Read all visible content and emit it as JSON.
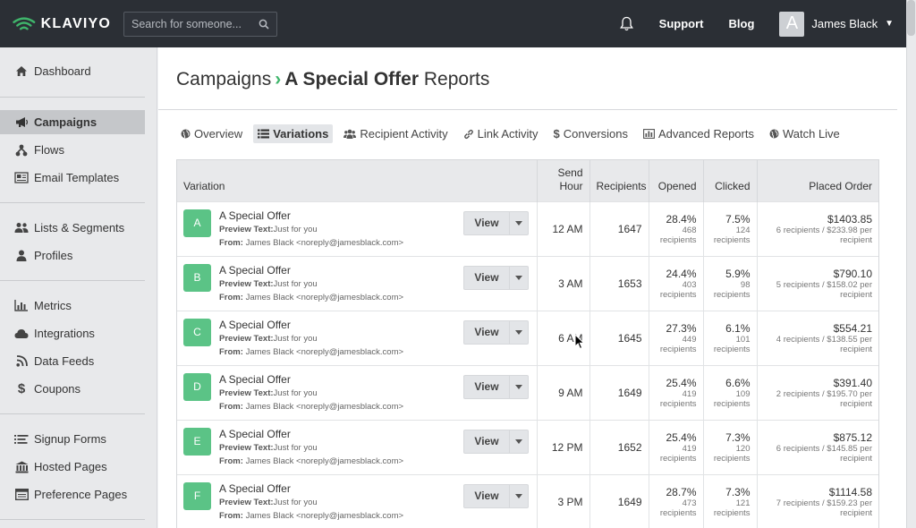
{
  "brand": {
    "name": "KLAVIYO",
    "accent": "#3fb56b"
  },
  "topbar": {
    "search_placeholder": "Search for someone...",
    "support": "Support",
    "blog": "Blog",
    "user_initial": "A",
    "user_name": "James Black"
  },
  "sidebar": {
    "items": [
      {
        "label": "Dashboard",
        "icon": "home-icon"
      },
      {
        "label": "Campaigns",
        "icon": "megaphone-icon",
        "active": true
      },
      {
        "label": "Flows",
        "icon": "flows-icon"
      },
      {
        "label": "Email Templates",
        "icon": "newspaper-icon"
      },
      {
        "label": "Lists & Segments",
        "icon": "users-icon"
      },
      {
        "label": "Profiles",
        "icon": "user-icon"
      },
      {
        "label": "Metrics",
        "icon": "bar-chart-icon"
      },
      {
        "label": "Integrations",
        "icon": "cloud-icon"
      },
      {
        "label": "Data Feeds",
        "icon": "rss-icon"
      },
      {
        "label": "Coupons",
        "icon": "dollar-icon"
      },
      {
        "label": "Signup Forms",
        "icon": "list-icon"
      },
      {
        "label": "Hosted Pages",
        "icon": "bank-icon"
      },
      {
        "label": "Preference Pages",
        "icon": "window-icon"
      }
    ]
  },
  "page": {
    "breadcrumb_root": "Campaigns",
    "breadcrumb_sep": "›",
    "campaign_name": "A Special Offer",
    "title_suffix": "Reports"
  },
  "tabs": [
    {
      "label": "Overview",
      "icon": "globe-icon"
    },
    {
      "label": "Variations",
      "icon": "list-icon",
      "active": true
    },
    {
      "label": "Recipient Activity",
      "icon": "users-icon"
    },
    {
      "label": "Link Activity",
      "icon": "link-icon"
    },
    {
      "label": "Conversions",
      "icon": "dollar-icon"
    },
    {
      "label": "Advanced Reports",
      "icon": "bar-chart-icon"
    },
    {
      "label": "Watch Live",
      "icon": "globe-icon"
    }
  ],
  "table": {
    "headers": {
      "variation": "Variation",
      "send_hour_1": "Send",
      "send_hour_2": "Hour",
      "recipients": "Recipients",
      "opened": "Opened",
      "clicked": "Clicked",
      "placed_order": "Placed Order"
    },
    "view_label": "View",
    "preview_label": "Preview Text:",
    "from_label": "From:",
    "rows": [
      {
        "letter": "A",
        "name": "A Special Offer",
        "preview": "Just for you",
        "from": "James Black <noreply@jamesblack.com>",
        "send_hour": "12 AM",
        "recipients": "1647",
        "opened_pct": "28.4%",
        "opened_n": "468",
        "opened_unit": "recipients",
        "clicked_pct": "7.5%",
        "clicked_n": "124",
        "clicked_unit": "recipients",
        "order_amt": "$1403.85",
        "order_line1": "6 recipients / $233.98 per",
        "order_line2": "recipient"
      },
      {
        "letter": "B",
        "name": "A Special Offer",
        "preview": "Just for you",
        "from": "James Black <noreply@jamesblack.com>",
        "send_hour": "3 AM",
        "recipients": "1653",
        "opened_pct": "24.4%",
        "opened_n": "403",
        "opened_unit": "recipients",
        "clicked_pct": "5.9%",
        "clicked_n": "98",
        "clicked_unit": "recipients",
        "order_amt": "$790.10",
        "order_line1": "5 recipients / $158.02 per",
        "order_line2": "recipient"
      },
      {
        "letter": "C",
        "name": "A Special Offer",
        "preview": "Just for you",
        "from": "James Black <noreply@jamesblack.com>",
        "send_hour": "6 AM",
        "recipients": "1645",
        "opened_pct": "27.3%",
        "opened_n": "449",
        "opened_unit": "recipients",
        "clicked_pct": "6.1%",
        "clicked_n": "101",
        "clicked_unit": "recipients",
        "order_amt": "$554.21",
        "order_line1": "4 recipients / $138.55 per",
        "order_line2": "recipient"
      },
      {
        "letter": "D",
        "name": "A Special Offer",
        "preview": "Just for you",
        "from": "James Black <noreply@jamesblack.com>",
        "send_hour": "9 AM",
        "recipients": "1649",
        "opened_pct": "25.4%",
        "opened_n": "419",
        "opened_unit": "recipients",
        "clicked_pct": "6.6%",
        "clicked_n": "109",
        "clicked_unit": "recipients",
        "order_amt": "$391.40",
        "order_line1": "2 recipients / $195.70 per",
        "order_line2": "recipient"
      },
      {
        "letter": "E",
        "name": "A Special Offer",
        "preview": "Just for you",
        "from": "James Black <noreply@jamesblack.com>",
        "send_hour": "12 PM",
        "recipients": "1652",
        "opened_pct": "25.4%",
        "opened_n": "419",
        "opened_unit": "recipients",
        "clicked_pct": "7.3%",
        "clicked_n": "120",
        "clicked_unit": "recipients",
        "order_amt": "$875.12",
        "order_line1": "6 recipients / $145.85 per",
        "order_line2": "recipient"
      },
      {
        "letter": "F",
        "name": "A Special Offer",
        "preview": "Just for you",
        "from": "James Black <noreply@jamesblack.com>",
        "send_hour": "3 PM",
        "recipients": "1649",
        "opened_pct": "28.7%",
        "opened_n": "473",
        "opened_unit": "recipients",
        "clicked_pct": "7.3%",
        "clicked_n": "121",
        "clicked_unit": "recipients",
        "order_amt": "$1114.58",
        "order_line1": "7 recipients / $159.23 per",
        "order_line2": "recipient"
      }
    ]
  }
}
